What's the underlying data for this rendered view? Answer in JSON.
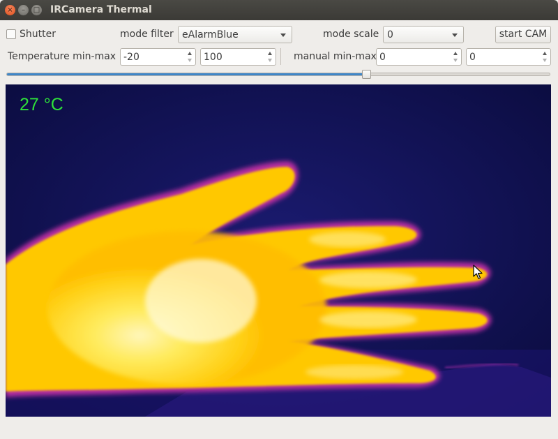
{
  "window": {
    "title": "IRCamera Thermal",
    "close_glyph": "×",
    "minimize_glyph": "–",
    "maximize_glyph": "□"
  },
  "controls": {
    "shutter_label": "Shutter",
    "shutter_checked": false,
    "mode_filter_label": "mode filter",
    "mode_filter_value": "eAlarmBlue",
    "mode_scale_label": "mode scale",
    "mode_scale_value": "0",
    "start_button": "start CAM",
    "temperature_label": "Temperature min-max",
    "temp_min": "-20",
    "temp_max": "100",
    "manual_label": "manual min-max",
    "manual_min": "0",
    "manual_max": "0"
  },
  "slider": {
    "value_fraction": 0.663
  },
  "thermal": {
    "temperature_readout": "27 °C",
    "readout_color": "#2ee23a"
  },
  "colors": {
    "accent": "#3e86c8",
    "hot": "#fff06a",
    "warm": "#ffc400",
    "edge": "#c9309a",
    "cold": "#0b0c40"
  },
  "icons": [
    "close-icon",
    "minimize-icon",
    "maximize-icon",
    "chevron-down-icon",
    "spin-up-icon",
    "spin-down-icon",
    "mouse-cursor-icon"
  ]
}
